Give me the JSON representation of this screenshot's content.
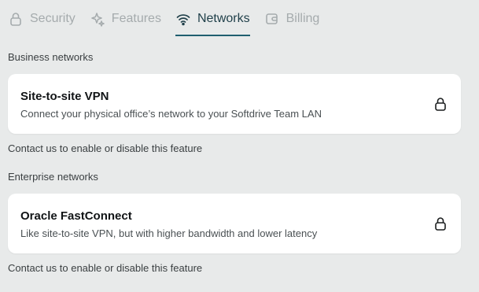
{
  "tabs": [
    {
      "label": "Security",
      "icon": "lock-icon",
      "active": false
    },
    {
      "label": "Features",
      "icon": "sparkle-icon",
      "active": false
    },
    {
      "label": "Networks",
      "icon": "wifi-icon",
      "active": true
    },
    {
      "label": "Billing",
      "icon": "wallet-icon",
      "active": false
    }
  ],
  "sections": [
    {
      "label": "Business networks",
      "card": {
        "title": "Site-to-site VPN",
        "description": "Connect your physical office’s network to your Softdrive Team LAN",
        "icon": "lock-icon"
      },
      "footnote": "Contact us to enable or disable this feature"
    },
    {
      "label": "Enterprise networks",
      "card": {
        "title": "Oracle FastConnect",
        "description": "Like site-to-site VPN, but with higher bandwidth and lower latency",
        "icon": "lock-icon"
      },
      "footnote": "Contact us to enable or disable this feature"
    }
  ],
  "colors": {
    "background": "#e8eaea",
    "active_tab": "#1f3f49",
    "inactive_tab": "#a5abad",
    "accent_underline": "#1f5f6f",
    "card": "#ffffff"
  }
}
